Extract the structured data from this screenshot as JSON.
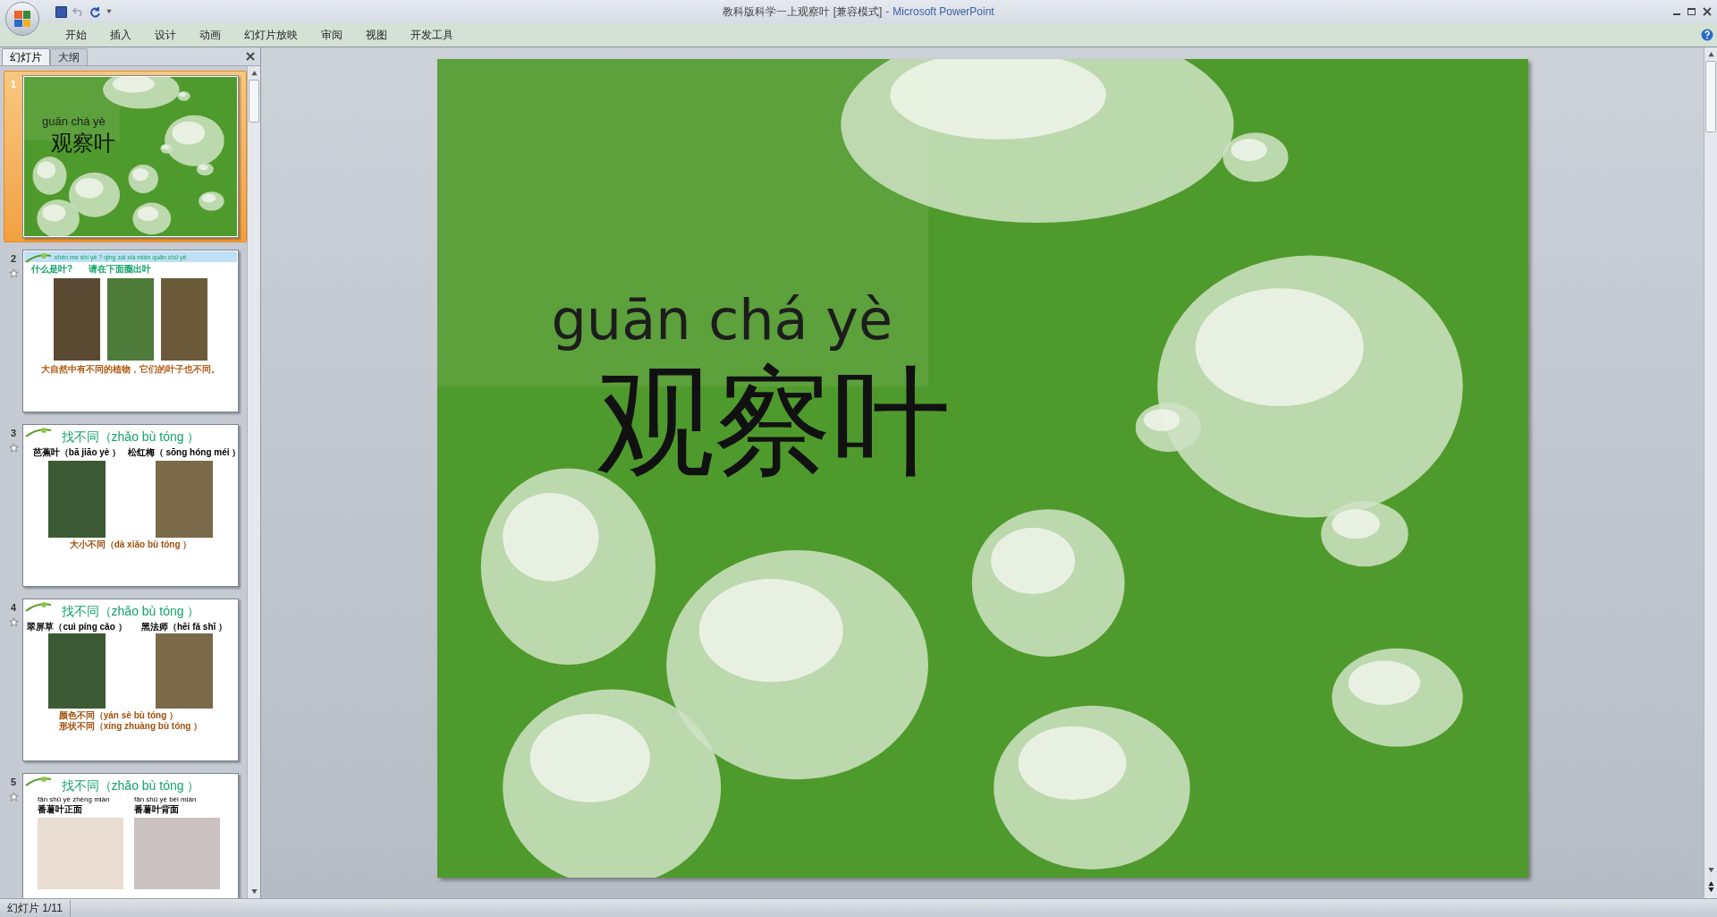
{
  "window": {
    "title": "教科版科学一上观察叶 [兼容模式]",
    "separator": "-",
    "app": "Microsoft PowerPoint"
  },
  "ribbon_tabs": [
    "开始",
    "插入",
    "设计",
    "动画",
    "幻灯片放映",
    "审阅",
    "视图",
    "开发工具"
  ],
  "panel_tabs": [
    {
      "label": "幻灯片",
      "selected": true
    },
    {
      "label": "大纲",
      "selected": false
    }
  ],
  "slides": [
    {
      "number": "1",
      "selected": true,
      "animated": false,
      "kind": "title",
      "pinyin": "guān chá yè",
      "title": "观察叶"
    },
    {
      "number": "2",
      "selected": false,
      "animated": true,
      "kind": "question",
      "pinyin": "shén me shì yè ? qǐng zài xià miàn quān chū yè",
      "questions": [
        "什么是叶?",
        "请在下面圈出叶"
      ],
      "caption": "大自然中有不同的植物，它们的叶子也不同。"
    },
    {
      "number": "3",
      "selected": false,
      "animated": true,
      "kind": "compare",
      "title": "找不同（zhǎo bù tóng ）",
      "labels": [
        "芭蕉叶（bā jiāo yè ）",
        "松红梅（ sōng hóng méi ）"
      ],
      "captions": [
        "大小不同（dà xiǎo bù tóng ）"
      ]
    },
    {
      "number": "4",
      "selected": false,
      "animated": true,
      "kind": "compare",
      "title": "找不同（zhǎo bù tóng ）",
      "labels": [
        "翠屏草（cuì píng cǎo ）",
        "黑法师（hēi fǎ shī ）"
      ],
      "captions": [
        "颜色不同（yán sè bù tóng ）",
        "形状不同（xíng zhuàng bù tóng ）"
      ]
    },
    {
      "number": "5",
      "selected": false,
      "animated": true,
      "kind": "leaf",
      "title": "找不同（zhǎo bù tóng ）",
      "labels": [
        {
          "pinyin": "fān shǔ yè zhèng miàn",
          "text": "番薯叶正面"
        },
        {
          "pinyin": "fān shǔ yè bèi miàn",
          "text": "番薯叶背面"
        }
      ]
    }
  ],
  "main_slide": {
    "pinyin": "guān chá yè",
    "title": "观察叶"
  },
  "status_bar": {
    "slide_info": "幻灯片 1/11"
  }
}
